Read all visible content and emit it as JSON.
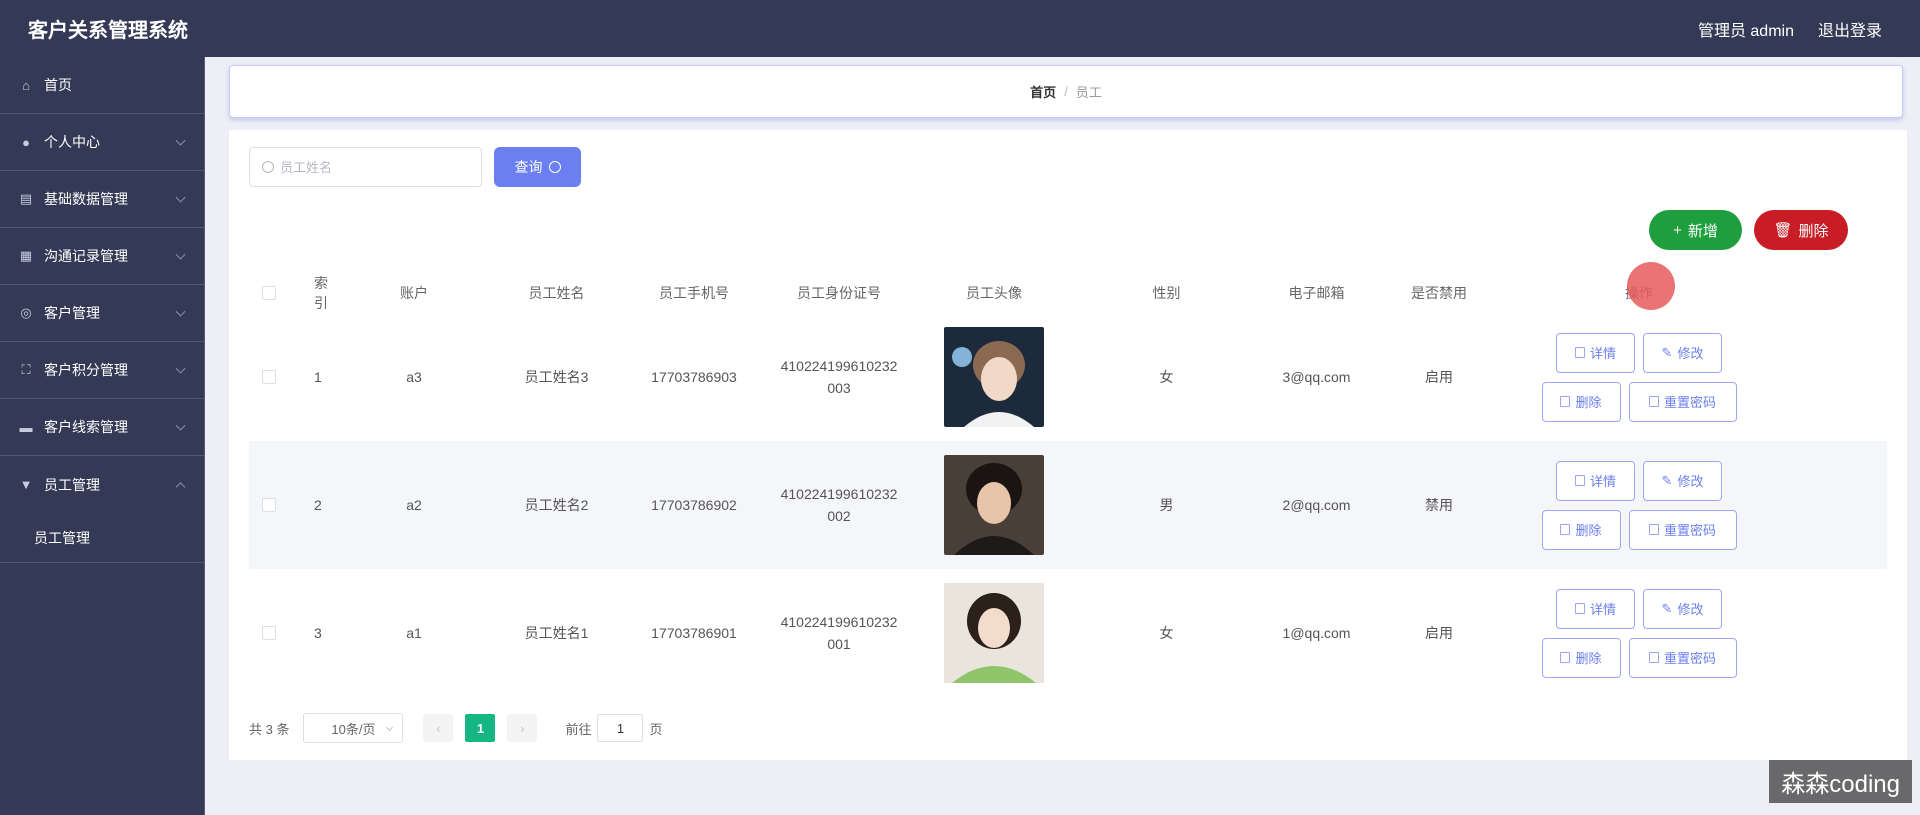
{
  "header": {
    "app_title": "客户关系管理系统",
    "user_label": "管理员 admin",
    "logout_label": "退出登录"
  },
  "sidebar": {
    "items": [
      {
        "label": "首页",
        "icon": "home-icon"
      },
      {
        "label": "个人中心",
        "icon": "user-icon"
      },
      {
        "label": "基础数据管理",
        "icon": "database-icon"
      },
      {
        "label": "沟通记录管理",
        "icon": "chat-icon"
      },
      {
        "label": "客户管理",
        "icon": "globe-icon"
      },
      {
        "label": "客户积分管理",
        "icon": "fullscreen-icon"
      },
      {
        "label": "客户线索管理",
        "icon": "message-icon"
      },
      {
        "label": "员工管理",
        "icon": "staff-icon"
      }
    ],
    "submenu": {
      "label": "员工管理"
    }
  },
  "breadcrumb": {
    "home": "首页",
    "separator": "/",
    "current": "员工"
  },
  "search": {
    "placeholder": "员工姓名",
    "query_label": "查询"
  },
  "toolbar": {
    "add_label": "新增",
    "delete_label": "删除"
  },
  "table": {
    "headers": [
      "索引",
      "账户",
      "员工姓名",
      "员工手机号",
      "员工身份证号",
      "员工头像",
      "性别",
      "电子邮箱",
      "是否禁用",
      "操作"
    ],
    "rows": [
      {
        "index": "1",
        "account": "a3",
        "name": "员工姓名3",
        "phone": "17703786903",
        "id_card": "410224199610232003",
        "gender": "女",
        "email": "3@qq.com",
        "disabled": "启用"
      },
      {
        "index": "2",
        "account": "a2",
        "name": "员工姓名2",
        "phone": "17703786902",
        "id_card": "410224199610232002",
        "gender": "男",
        "email": "2@qq.com",
        "disabled": "禁用"
      },
      {
        "index": "3",
        "account": "a1",
        "name": "员工姓名1",
        "phone": "17703786901",
        "id_card": "410224199610232001",
        "gender": "女",
        "email": "1@qq.com",
        "disabled": "启用"
      }
    ],
    "actions": {
      "detail": "详情",
      "edit": "修改",
      "delete": "删除",
      "reset_password": "重置密码"
    }
  },
  "pagination": {
    "total": "共 3 条",
    "page_size": "10条/页",
    "prev": "‹",
    "current_page": "1",
    "next": "›",
    "goto_prefix": "前往",
    "goto_value": "1",
    "goto_suffix": "页"
  },
  "watermark": "森森coding",
  "colors": {
    "primary": "#6b7ff0",
    "success": "#1e9e3d",
    "danger": "#c81d25",
    "sidebar": "#343a56",
    "page_active": "#15b682"
  }
}
